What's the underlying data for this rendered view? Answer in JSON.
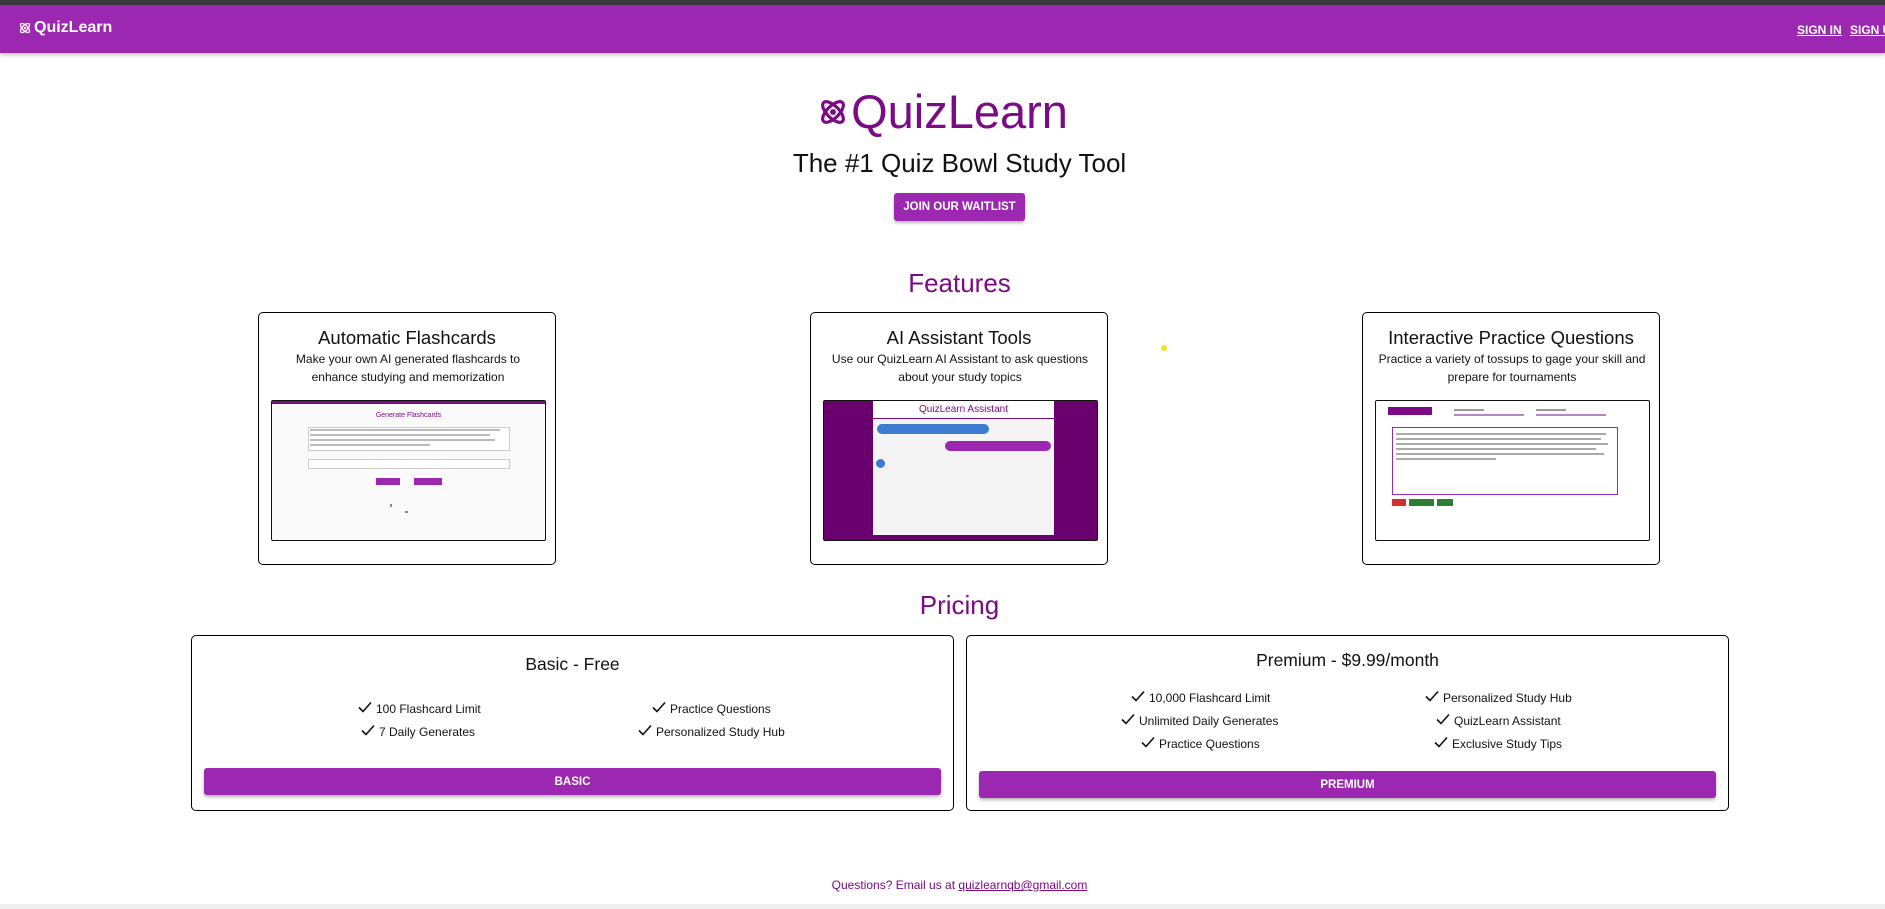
{
  "navbar": {
    "brand": "QuizLearn",
    "sign_in": "SIGN IN",
    "sign_up": "SIGN UP"
  },
  "hero": {
    "title": "QuizLearn",
    "subtitle": "The #1 Quiz Bowl Study Tool",
    "waitlist_button": "JOIN OUR WAITLIST"
  },
  "features": {
    "title": "Features",
    "cards": [
      {
        "title": "Automatic Flashcards",
        "description": "Make your own AI generated flashcards to enhance studying and memorization",
        "preview": {
          "heading": "Generate Flashcards"
        }
      },
      {
        "title": "AI Assistant Tools",
        "description": "Use our QuizLearn AI Assistant to ask questions about your study topics",
        "preview": {
          "heading": "QuizLearn Assistant"
        }
      },
      {
        "title": "Interactive Practice Questions",
        "description": "Practice a variety of tossups to gage your skill and prepare for tournaments",
        "preview": {
          "heading": ""
        }
      }
    ]
  },
  "pricing": {
    "title": "Pricing",
    "plans": [
      {
        "name": "Basic - Free",
        "button": "BASIC",
        "features_left": [
          "100 Flashcard Limit",
          "7 Daily Generates"
        ],
        "features_right": [
          "Practice Questions",
          "Personalized Study Hub"
        ]
      },
      {
        "name": "Premium - $9.99/month",
        "button": "PREMIUM",
        "features_left": [
          "10,000 Flashcard Limit",
          "Unlimited Daily Generates",
          "Practice Questions"
        ],
        "features_right": [
          "Personalized Study Hub",
          "QuizLearn Assistant",
          "Exclusive Study Tips"
        ]
      }
    ]
  },
  "footer": {
    "text": "Questions? Email us at",
    "email": "quizlearnqb@gmail.com"
  },
  "colors": {
    "primary": "#9c27b0",
    "brand_text": "#7b0a85"
  },
  "icons": {
    "logo": "atom-logo-icon",
    "check": "checkmark-icon"
  }
}
